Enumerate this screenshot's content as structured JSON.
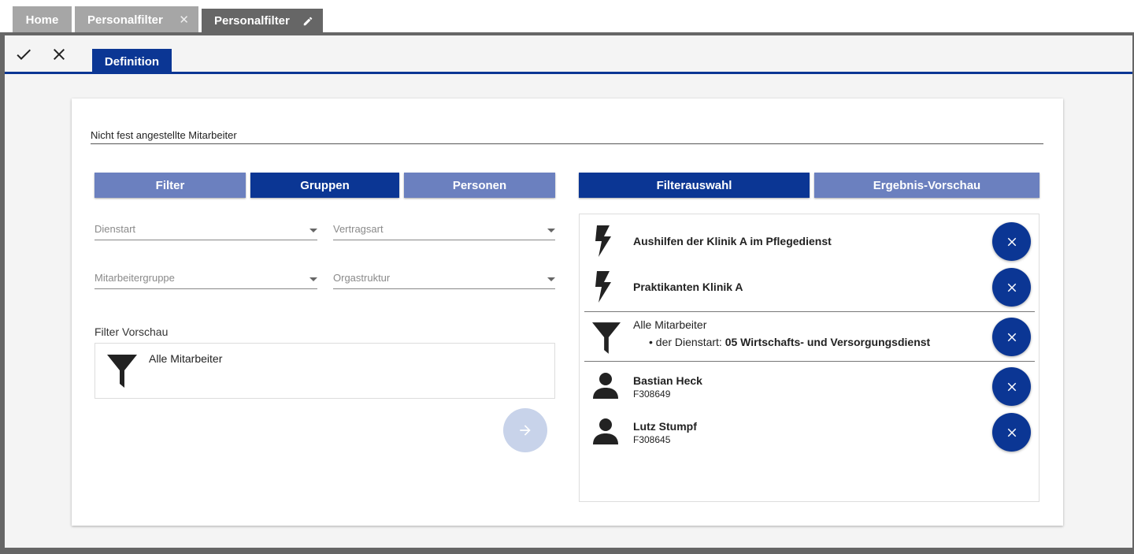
{
  "tabs": {
    "home": "Home",
    "personalfilter_1": "Personalfilter",
    "personalfilter_2": "Personalfilter"
  },
  "toolbar": {
    "definition_tab": "Definition"
  },
  "form": {
    "name_value": "Nicht fest angestellte Mitarbeiter"
  },
  "left": {
    "buttons": {
      "filter": "Filter",
      "gruppen": "Gruppen",
      "personen": "Personen"
    },
    "selects": {
      "dienstart": "Dienstart",
      "vertragsart": "Vertragsart",
      "mitarbeitergruppe": "Mitarbeitergruppe",
      "orgastruktur": "Orgastruktur"
    },
    "filter_preview_label": "Filter Vorschau",
    "filter_preview_text": "Alle Mitarbeiter"
  },
  "right": {
    "buttons": {
      "filterauswahl": "Filterauswahl",
      "ergebnis": "Ergebnis-Vorschau"
    },
    "items": [
      {
        "type": "group",
        "title": "Aushilfen der Klinik A im Pflegedienst"
      },
      {
        "type": "group",
        "title": "Praktikanten Klinik A"
      },
      {
        "type": "filter",
        "title": "Alle Mitarbeiter",
        "condition_prefix": "• der Dienstart: ",
        "condition_value": "05 Wirtschafts- und Versorgungsdienst"
      },
      {
        "type": "person",
        "name": "Bastian Heck",
        "id": "F308649"
      },
      {
        "type": "person",
        "name": "Lutz Stumpf",
        "id": "F308645"
      }
    ]
  },
  "colors": {
    "primary": "#0b3694",
    "primary_light": "#6b80bf",
    "tab_gray": "#a6a6a6",
    "tab_dark": "#666666"
  }
}
